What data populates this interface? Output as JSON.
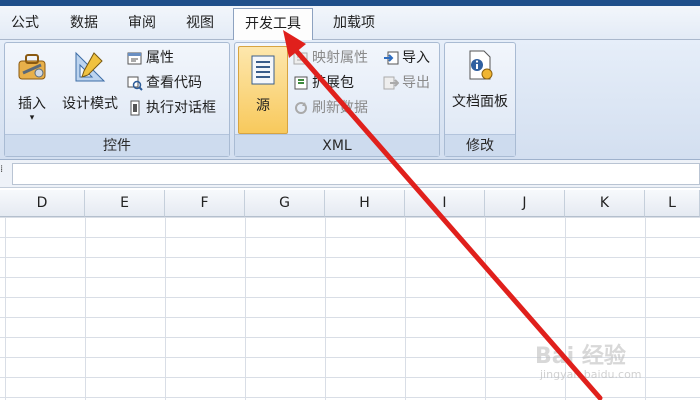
{
  "tabs": [
    {
      "label": "公式"
    },
    {
      "label": "数据"
    },
    {
      "label": "审阅"
    },
    {
      "label": "视图"
    },
    {
      "label": "开发工具"
    },
    {
      "label": "加载项"
    }
  ],
  "active_tab": "开发工具",
  "ribbon": {
    "controls": {
      "label": "控件",
      "insert": "插入",
      "design_mode": "设计模式",
      "properties": "属性",
      "view_code": "查看代码",
      "run_dialog": "执行对话框"
    },
    "xml": {
      "label": "XML",
      "source": "源",
      "map_properties": "映射属性",
      "expansion_packs": "扩展包",
      "refresh_data": "刷新数据",
      "import": "导入",
      "export": "导出"
    },
    "modify": {
      "label": "修改",
      "document_panel": "文档面板"
    }
  },
  "columns": [
    "D",
    "E",
    "F",
    "G",
    "H",
    "I",
    "J",
    "K",
    "L"
  ],
  "watermark": {
    "brand": "Bai 经验",
    "url": "jingyan.baidu.com"
  },
  "colors": {
    "accent": "#1f4f8a",
    "arrow": "#e0201c",
    "source_button": "#fbd88a"
  }
}
